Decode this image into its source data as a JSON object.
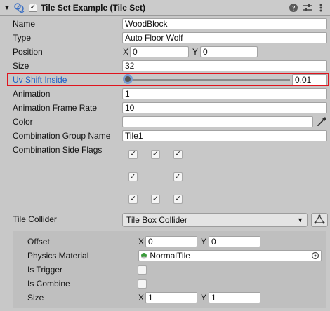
{
  "header": {
    "title": "Tile Set Example (Tile Set)",
    "enabled": true,
    "icons": [
      "collapse-arrow-icon",
      "tile-set-component-icon",
      "help-icon",
      "preset-sliders-icon",
      "more-options-icon"
    ]
  },
  "properties": {
    "name": {
      "label": "Name",
      "value": "WoodBlock"
    },
    "type": {
      "label": "Type",
      "value": "Auto Floor Wolf"
    },
    "position": {
      "label": "Position",
      "x_label": "X",
      "x": "0",
      "y_label": "Y",
      "y": "0"
    },
    "size": {
      "label": "Size",
      "value": "32"
    },
    "uv_shift_inside": {
      "label": "Uv Shift Inside",
      "value": "0.01",
      "slider_fraction": 0.01
    },
    "animation": {
      "label": "Animation",
      "value": "1"
    },
    "animation_frame_rate": {
      "label": "Animation Frame Rate",
      "value": "10"
    },
    "color": {
      "label": "Color",
      "value": "#ffffff"
    },
    "combination_group_name": {
      "label": "Combination Group Name",
      "value": "Tile1"
    },
    "combination_side_flags": {
      "label": "Combination Side Flags",
      "grid": [
        [
          true,
          true,
          true
        ],
        [
          true,
          false,
          true
        ],
        [
          true,
          true,
          true
        ]
      ]
    },
    "tile_collider": {
      "label": "Tile Collider",
      "value": "Tile Box Collider"
    }
  },
  "collider": {
    "offset": {
      "label": "Offset",
      "x_label": "X",
      "x": "0",
      "y_label": "Y",
      "y": "0"
    },
    "physics_material": {
      "label": "Physics Material",
      "value": "NormalTile"
    },
    "is_trigger": {
      "label": "Is Trigger",
      "checked": false
    },
    "is_combine": {
      "label": "Is Combine",
      "checked": false
    },
    "size": {
      "label": "Size",
      "x_label": "X",
      "x": "1",
      "y_label": "Y",
      "y": "1"
    }
  },
  "check_mark": "✓"
}
